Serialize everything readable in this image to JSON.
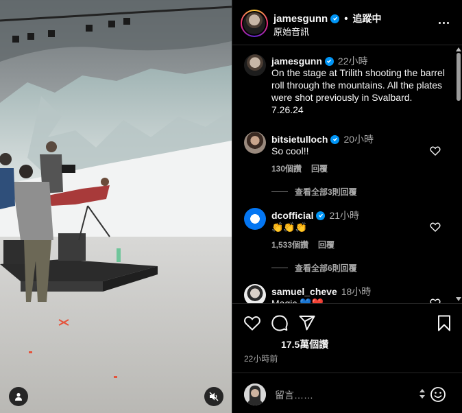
{
  "post": {
    "username": "jamesgunn",
    "follow_label": "追蹤中",
    "audio_label": "原始音訊",
    "caption_time": "22小時",
    "caption": "On the stage at Trilith shooting the barrel roll through the mountains. All the plates were shot previously in Svalbard. 7.26.24",
    "likes": "17.5萬個讚",
    "posted_ago": "22小時前",
    "comment_placeholder": "留言……"
  },
  "comments": [
    {
      "username": "bitsietulloch",
      "time": "20小時",
      "text": "So cool!!",
      "likes": "130個讚",
      "reply_label": "回覆",
      "view_replies": "查看全部3則回覆"
    },
    {
      "username": "dcofficial",
      "time": "21小時",
      "text": "👏👏👏",
      "likes": "1,533個讚",
      "reply_label": "回覆",
      "view_replies": "查看全部6則回覆"
    },
    {
      "username": "samuel_cheve",
      "time": "18小時",
      "text": "Magic 💙❤️"
    }
  ],
  "icons": {
    "verified": "verified-badge-icon",
    "more": "more-options-icon",
    "like": "heart-icon",
    "comment": "comment-icon",
    "share": "share-icon",
    "save": "bookmark-icon",
    "emoji": "emoji-icon",
    "user_tag": "user-icon",
    "mute": "speaker-muted-icon"
  },
  "colors": {
    "background": "#000000",
    "verified": "#0095f6",
    "secondary_text": "#a8a8a8",
    "divider": "#262626"
  }
}
